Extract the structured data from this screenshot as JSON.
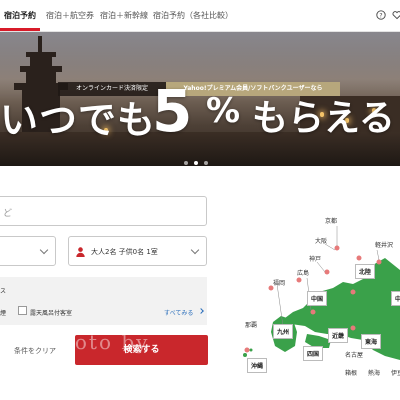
{
  "nav": {
    "tabs": [
      {
        "label": "宿泊予約",
        "active": true
      },
      {
        "label": "宿泊＋航空券",
        "active": false
      },
      {
        "label": "宿泊＋新幹線",
        "active": false
      },
      {
        "label": "宿泊予約（各社比較）",
        "active": false
      }
    ],
    "icons": [
      "help-icon",
      "heart-icon"
    ],
    "accent": "#d81b29"
  },
  "hero": {
    "badge_left": "オンラインカード決済限定",
    "badge_right": "Yahoo!プレミアム会員/ソフトバンクユーザーなら",
    "headline_1": "いつでも",
    "headline_2": "5",
    "headline_3": "%",
    "headline_4": "もらえる",
    "slide_count": 3,
    "active_slide": 1
  },
  "form": {
    "destination_placeholder": "ど",
    "guests": "大人2名  子供0名  1室",
    "options_title": "ス",
    "option_label_1": "煙",
    "option_label_2": "露天風呂付客室",
    "see_all": "すべてみる",
    "clear": "条件をクリア",
    "search": "検索する",
    "search_color": "#c9272c",
    "watermark": "hoto by"
  },
  "map": {
    "labels": [
      "京都",
      "大阪",
      "軽井沢",
      "神戸",
      "広島",
      "福岡",
      "那覇",
      "名古屋",
      "箱根",
      "熱海",
      "伊豆"
    ],
    "regions": [
      "北陸",
      "中国",
      "中",
      "九州",
      "近畿",
      "四国",
      "東海",
      "沖縄"
    ],
    "land_color": "#3aa14a",
    "pin_color": "#e77a7a"
  }
}
